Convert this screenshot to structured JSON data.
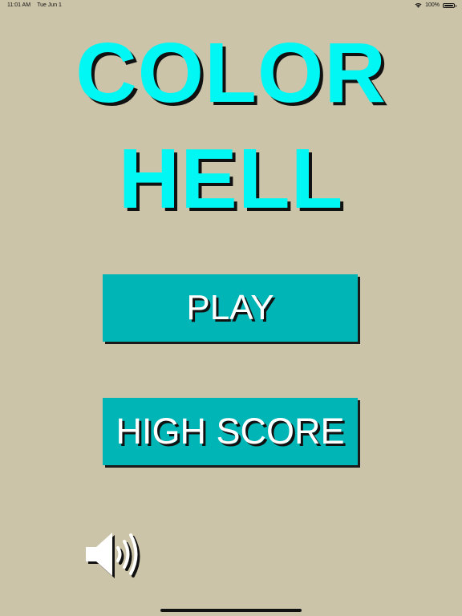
{
  "status_bar": {
    "time": "11:01 AM",
    "date": "Tue Jun 1",
    "battery": "100%",
    "icons": [
      "wifi-icon",
      "battery-icon"
    ]
  },
  "title": {
    "line1": "COLOR",
    "line2": "HELL"
  },
  "menu": {
    "play_label": "PLAY",
    "high_score_label": "HIGH SCORE"
  },
  "sound": {
    "icon": "speaker-icon"
  },
  "colors": {
    "background": "#ccc4a8",
    "title": "#00f7f3",
    "button": "#00b5b5",
    "shadow": "#111111",
    "button_text": "#ffffff"
  }
}
